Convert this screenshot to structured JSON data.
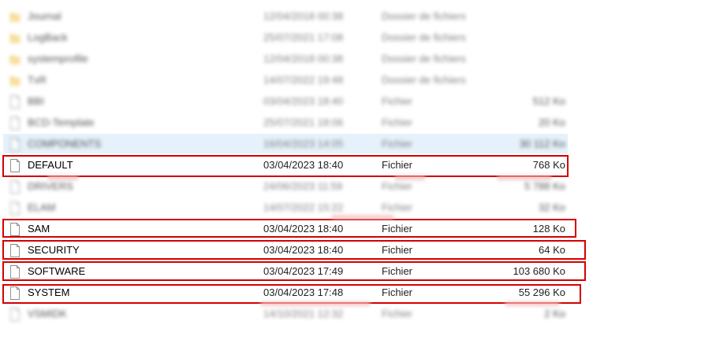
{
  "rows": [
    {
      "name": "Journal",
      "date": "12/04/2018 00:38",
      "type": "Dossier de fichiers",
      "size": "",
      "kind": "folder",
      "blur": true
    },
    {
      "name": "LogBack",
      "date": "25/07/2021 17:08",
      "type": "Dossier de fichiers",
      "size": "",
      "kind": "folder",
      "blur": true
    },
    {
      "name": "systemprofile",
      "date": "12/04/2018 00:38",
      "type": "Dossier de fichiers",
      "size": "",
      "kind": "folder",
      "blur": true
    },
    {
      "name": "TxR",
      "date": "14/07/2022 19:48",
      "type": "Dossier de fichiers",
      "size": "",
      "kind": "folder",
      "blur": true
    },
    {
      "name": "BBI",
      "date": "03/04/2023 18:40",
      "type": "Fichier",
      "size": "512 Ko",
      "kind": "file",
      "blur": true
    },
    {
      "name": "BCD-Template",
      "date": "25/07/2021 18:06",
      "type": "Fichier",
      "size": "20 Ko",
      "kind": "file",
      "blur": true
    },
    {
      "name": "COMPONENTS",
      "date": "16/04/2023 14:05",
      "type": "Fichier",
      "size": "30 112 Ko",
      "kind": "file",
      "blur": true,
      "selected": true
    },
    {
      "name": "DEFAULT",
      "date": "03/04/2023 18:40",
      "type": "Fichier",
      "size": "768 Ko",
      "kind": "file",
      "blur": false
    },
    {
      "name": "DRIVERS",
      "date": "24/06/2023 11:59",
      "type": "Fichier",
      "size": "5 788 Ko",
      "kind": "file",
      "blur": true
    },
    {
      "name": "ELAM",
      "date": "14/07/2022 15:22",
      "type": "Fichier",
      "size": "32 Ko",
      "kind": "file",
      "blur": true
    },
    {
      "name": "SAM",
      "date": "03/04/2023 18:40",
      "type": "Fichier",
      "size": "128 Ko",
      "kind": "file",
      "blur": false
    },
    {
      "name": "SECURITY",
      "date": "03/04/2023 18:40",
      "type": "Fichier",
      "size": "64 Ko",
      "kind": "file",
      "blur": false
    },
    {
      "name": "SOFTWARE",
      "date": "03/04/2023 17:49",
      "type": "Fichier",
      "size": "103 680 Ko",
      "kind": "file",
      "blur": false
    },
    {
      "name": "SYSTEM",
      "date": "03/04/2023 17:48",
      "type": "Fichier",
      "size": "55 296 Ko",
      "kind": "file",
      "blur": false
    },
    {
      "name": "VSMIDK",
      "date": "14/10/2021 12:32",
      "type": "Fichier",
      "size": "2 Ko",
      "kind": "file",
      "blur": true
    }
  ],
  "colors": {
    "highlight": "#d40000",
    "folder": "#f0c050",
    "selection": "#e5f1fb"
  }
}
